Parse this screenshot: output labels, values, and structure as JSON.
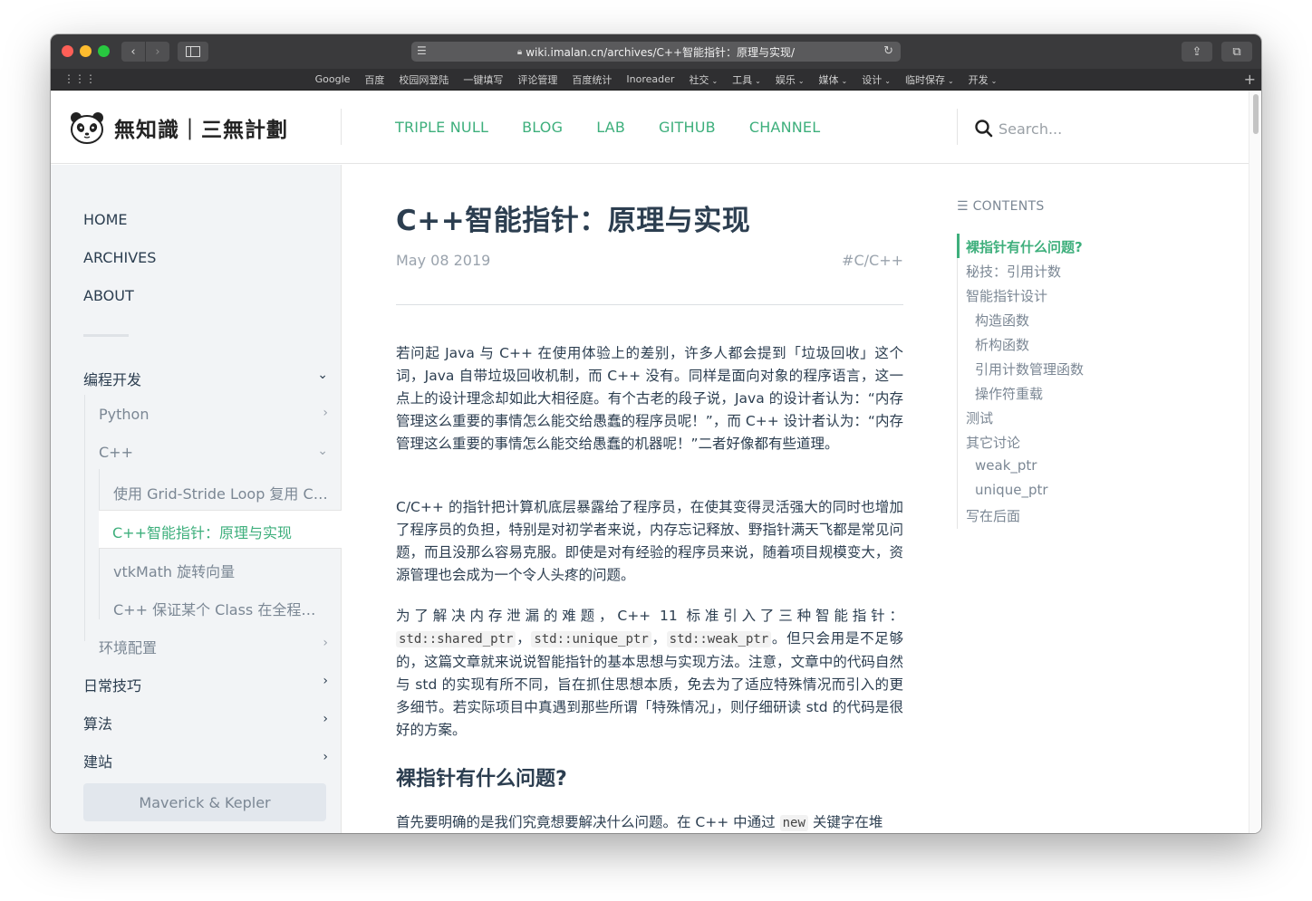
{
  "browser": {
    "url": "wiki.imalan.cn/archives/C++智能指针：原理与实现/",
    "bookmarks": [
      {
        "label": "Google",
        "dropdown": false
      },
      {
        "label": "百度",
        "dropdown": false
      },
      {
        "label": "校园网登陆",
        "dropdown": false
      },
      {
        "label": "一键填写",
        "dropdown": false
      },
      {
        "label": "评论管理",
        "dropdown": false
      },
      {
        "label": "百度统计",
        "dropdown": false
      },
      {
        "label": "Inoreader",
        "dropdown": false
      },
      {
        "label": "社交",
        "dropdown": true
      },
      {
        "label": "工具",
        "dropdown": true
      },
      {
        "label": "娱乐",
        "dropdown": true
      },
      {
        "label": "媒体",
        "dropdown": true
      },
      {
        "label": "设计",
        "dropdown": true
      },
      {
        "label": "临时保存",
        "dropdown": true
      },
      {
        "label": "开发",
        "dropdown": true
      }
    ]
  },
  "site": {
    "logo_text": "無知識｜三無計劃",
    "nav": [
      "TRIPLE NULL",
      "BLOG",
      "LAB",
      "GITHUB",
      "CHANNEL"
    ],
    "search_placeholder": "Search..."
  },
  "sidebar": {
    "links": [
      "HOME",
      "ARCHIVES",
      "ABOUT"
    ],
    "categories": [
      {
        "label": "编程开发",
        "expanded": true
      },
      {
        "label": "日常技巧",
        "expanded": false
      },
      {
        "label": "算法",
        "expanded": false
      },
      {
        "label": "建站",
        "expanded": false
      }
    ],
    "subcategories": [
      {
        "label": "Python",
        "expanded": false
      },
      {
        "label": "C++",
        "expanded": true
      },
      {
        "label": "环境配置",
        "expanded": false
      }
    ],
    "posts": [
      "使用 Grid-Stride Loop 复用 CUDA 线程",
      "C++智能指针：原理与实现",
      "vtkMath 旋转向量",
      "C++ 保证某个 Class 在全程序中唯一实例"
    ],
    "active_post_index": 1,
    "author_button": "Maverick & Kepler"
  },
  "post": {
    "title": "C++智能指针：原理与实现",
    "date": "May 08 2019",
    "tag": "#C/C++",
    "p1": "若问起 Java 与 C++ 在使用体验上的差别，许多人都会提到「垃圾回收」这个词，Java 自带垃圾回收机制，而 C++ 没有。同样是面向对象的程序语言，这一点上的设计理念却如此大相径庭。有个古老的段子说，Java 的设计者认为：“内存管理这么重要的事情怎么能交给愚蠢的程序员呢！”，而 C++ 设计者认为：“内存管理这么重要的事情怎么能交给愚蠢的机器呢！”二者好像都有些道理。",
    "p2": "C/C++ 的指针把计算机底层暴露给了程序员，在使其变得灵活强大的同时也增加了程序员的负担，特别是对初学者来说，内存忘记释放、野指针满天飞都是常见问题，而且没那么容易克服。即使是对有经验的程序员来说，随着项目规模变大，资源管理也会成为一个令人头疼的问题。",
    "p3_a": "为了解决内存泄漏的难题，C++ 11 标准引入了三种智能指针：",
    "p3_code1": "std::shared_ptr",
    "p3_sep1": "，",
    "p3_code2": "std::unique_ptr",
    "p3_sep2": "，",
    "p3_code3": "std::weak_ptr",
    "p3_b": "。但只会用是不足够的，这篇文章就来说说智能指针的基本思想与实现方法。注意，文章中的代码自然与 std 的实现有所不同，旨在抓住思想本质，免去为了适应特殊情况而引入的更多细节。若实际项目中真遇到那些所谓「特殊情况」，则仔细研读 std 的代码是很好的方案。",
    "h2": "裸指针有什么问题?",
    "p4_a": "首先要明确的是我们究竟想要解决什么问题。在 C++ 中通过 ",
    "p4_code": "new",
    "p4_b": " 关键字在堆"
  },
  "toc": {
    "heading": "CONTENTS",
    "items": [
      {
        "label": "裸指针有什么问题?",
        "level": 1,
        "active": true
      },
      {
        "label": "秘技：引用计数",
        "level": 1,
        "active": false
      },
      {
        "label": "智能指针设计",
        "level": 1,
        "active": false
      },
      {
        "label": "构造函数",
        "level": 2,
        "active": false
      },
      {
        "label": "析构函数",
        "level": 2,
        "active": false
      },
      {
        "label": "引用计数管理函数",
        "level": 2,
        "active": false
      },
      {
        "label": "操作符重载",
        "level": 2,
        "active": false
      },
      {
        "label": "测试",
        "level": 1,
        "active": false
      },
      {
        "label": "其它讨论",
        "level": 1,
        "active": false
      },
      {
        "label": "weak_ptr",
        "level": 2,
        "active": false
      },
      {
        "label": "unique_ptr",
        "level": 2,
        "active": false
      },
      {
        "label": "写在后面",
        "level": 1,
        "active": false
      }
    ]
  },
  "colors": {
    "accent": "#3eaf7c",
    "text": "#2c3e50",
    "muted": "#7b8794",
    "sidebar_bg": "#f2f4f6"
  }
}
